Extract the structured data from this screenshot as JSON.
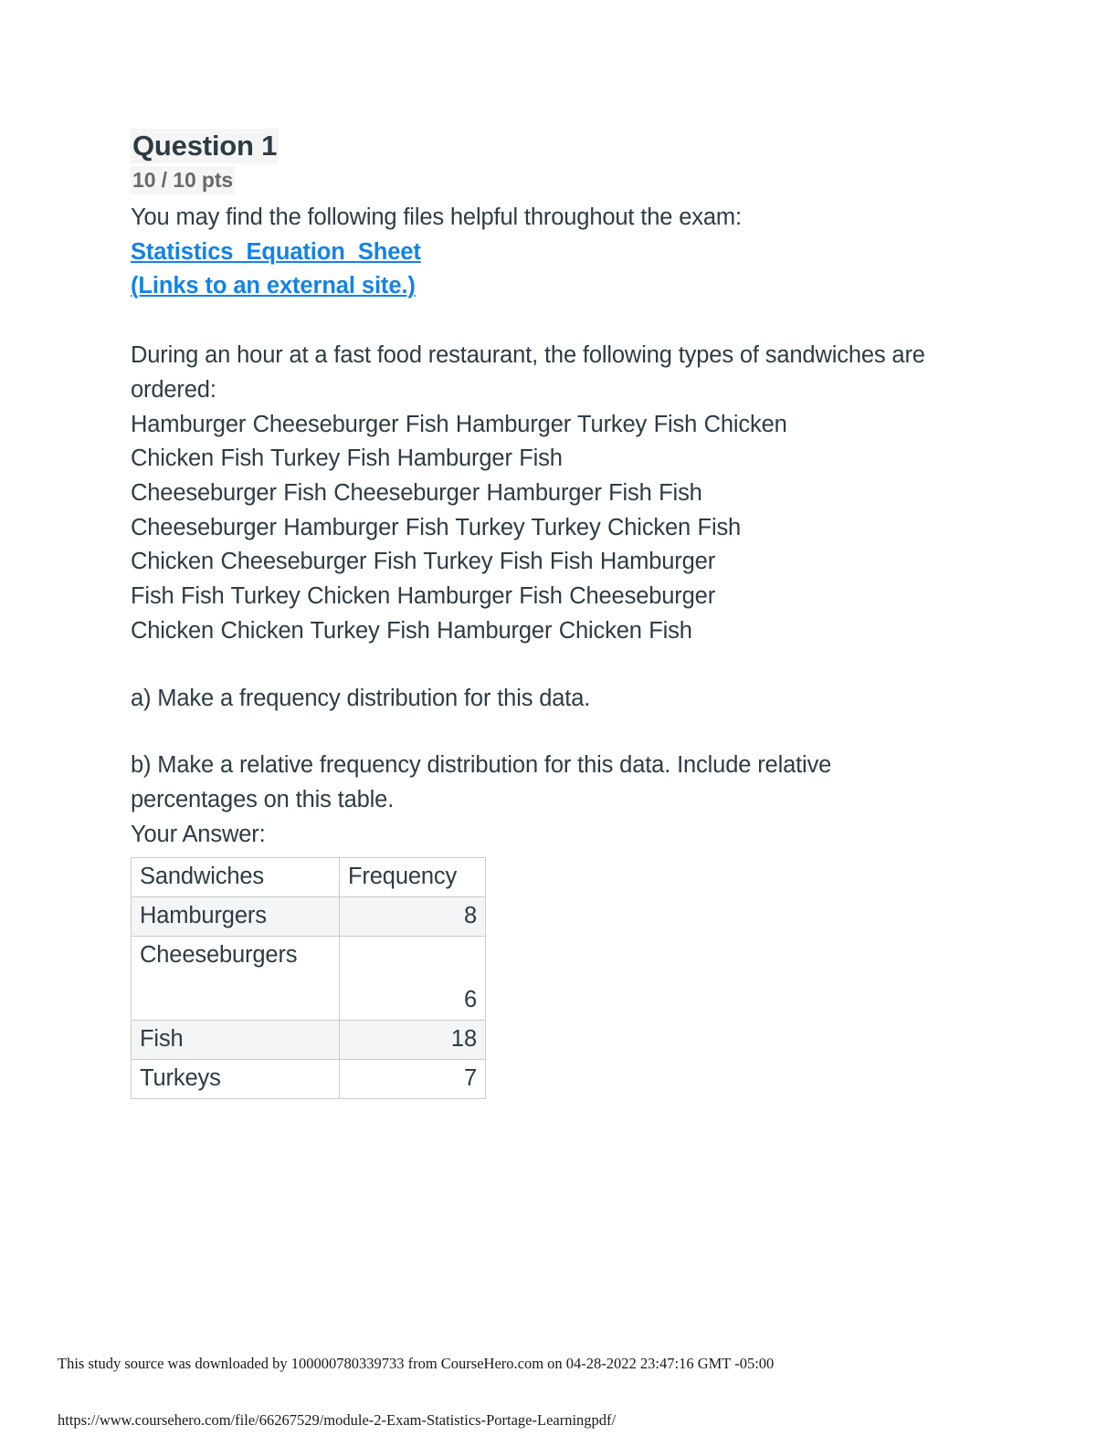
{
  "question": {
    "title": "Question 1",
    "points": "10 / 10 pts"
  },
  "intro": {
    "files_note": "You may find the following files helpful throughout the exam:",
    "link_label": "Statistics_Equation_Sheet",
    "link_sub_label": " (Links to an external site.)",
    "link_color": "#1283E8"
  },
  "prompt": {
    "scenario": "During an hour at a fast food restaurant, the following types of sandwiches are ordered:",
    "data_rows": [
      "Hamburger Cheeseburger Fish Hamburger Turkey Fish Chicken",
      "Chicken Fish Turkey Fish Hamburger Fish",
      "Cheeseburger Fish Cheeseburger Hamburger Fish Fish",
      "Cheeseburger Hamburger Fish Turkey Turkey Chicken Fish",
      "Chicken Cheeseburger Fish Turkey Fish Fish Hamburger",
      "Fish Fish Turkey Chicken Hamburger Fish Cheeseburger",
      "Chicken Chicken Turkey Fish Hamburger Chicken Fish"
    ],
    "part_a": "a) Make a frequency distribution for this data.",
    "part_b": "b) Make a relative frequency distribution for this data. Include relative percentages on this table.",
    "answer_label": "Your Answer:"
  },
  "answer_table": {
    "headers": [
      "Sandwiches",
      "Frequency"
    ],
    "rows": [
      {
        "label": "Hamburgers",
        "frequency": "8"
      },
      {
        "label": "Cheeseburgers",
        "frequency": "6"
      },
      {
        "label": "Fish",
        "frequency": "18"
      },
      {
        "label": "Turkeys",
        "frequency": "7"
      }
    ]
  },
  "footer": {
    "download_note": "This study source was downloaded by 100000780339733 from CourseHero.com on 04-28-2022 23:47:16 GMT -05:00",
    "url": "https://www.coursehero.com/file/66267529/module-2-Exam-Statistics-Portage-Learningpdf/"
  }
}
